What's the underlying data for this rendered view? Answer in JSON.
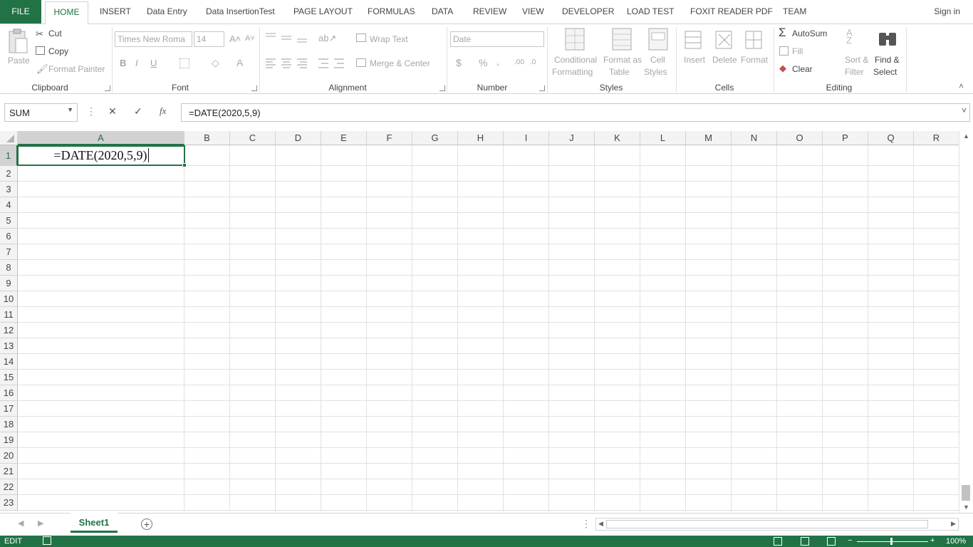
{
  "ribbon_tabs": [
    "FILE",
    "HOME",
    "INSERT",
    "Data Entry",
    "Data InsertionTest",
    "PAGE LAYOUT",
    "FORMULAS",
    "DATA",
    "REVIEW",
    "VIEW",
    "DEVELOPER",
    "LOAD TEST",
    "FOXIT READER PDF",
    "TEAM"
  ],
  "sign_in": "Sign in",
  "clipboard": {
    "paste": "Paste",
    "cut": "Cut",
    "copy": "Copy",
    "format_painter": "Format Painter",
    "label": "Clipboard"
  },
  "font": {
    "name": "Times New Roma",
    "size": "14",
    "bold": "B",
    "italic": "I",
    "underline": "U",
    "label": "Font"
  },
  "alignment": {
    "wrap_text": "Wrap Text",
    "merge_center": "Merge & Center",
    "label": "Alignment"
  },
  "number": {
    "format": "Date",
    "currency": "$",
    "percent": "%",
    "comma": ",",
    "label": "Number"
  },
  "styles": {
    "conditional_1": "Conditional",
    "conditional_2": "Formatting",
    "format_as_1": "Format as",
    "format_as_2": "Table",
    "cell_1": "Cell",
    "cell_2": "Styles",
    "label": "Styles"
  },
  "cells": {
    "insert": "Insert",
    "delete": "Delete",
    "format": "Format",
    "label": "Cells"
  },
  "editing": {
    "autosum": "AutoSum",
    "fill": "Fill",
    "clear": "Clear",
    "sort_1": "Sort &",
    "sort_2": "Filter",
    "find_1": "Find &",
    "find_2": "Select",
    "label": "Editing"
  },
  "formula_bar": {
    "name_box": "SUM",
    "cancel": "✕",
    "enter": "✓",
    "fx": "fx",
    "formula": "=DATE(2020,5,9)"
  },
  "columns": [
    "A",
    "B",
    "C",
    "D",
    "E",
    "F",
    "G",
    "H",
    "I",
    "J",
    "K",
    "L",
    "M",
    "N",
    "O",
    "P",
    "Q",
    "R"
  ],
  "rows": [
    "1",
    "2",
    "3",
    "4",
    "5",
    "6",
    "7",
    "8",
    "9",
    "10",
    "11",
    "12",
    "13",
    "14",
    "15",
    "16",
    "17",
    "18",
    "19",
    "20",
    "21",
    "22",
    "23"
  ],
  "active_cell": {
    "ref": "A1",
    "content": "=DATE(2020,5,9)"
  },
  "sheet_tabs": [
    "Sheet1"
  ],
  "status": {
    "mode": "EDIT",
    "zoom": "100%"
  },
  "colors": {
    "accent": "#217346",
    "header_bg": "#f3f3f3",
    "gridline": "#e1e1e1"
  }
}
